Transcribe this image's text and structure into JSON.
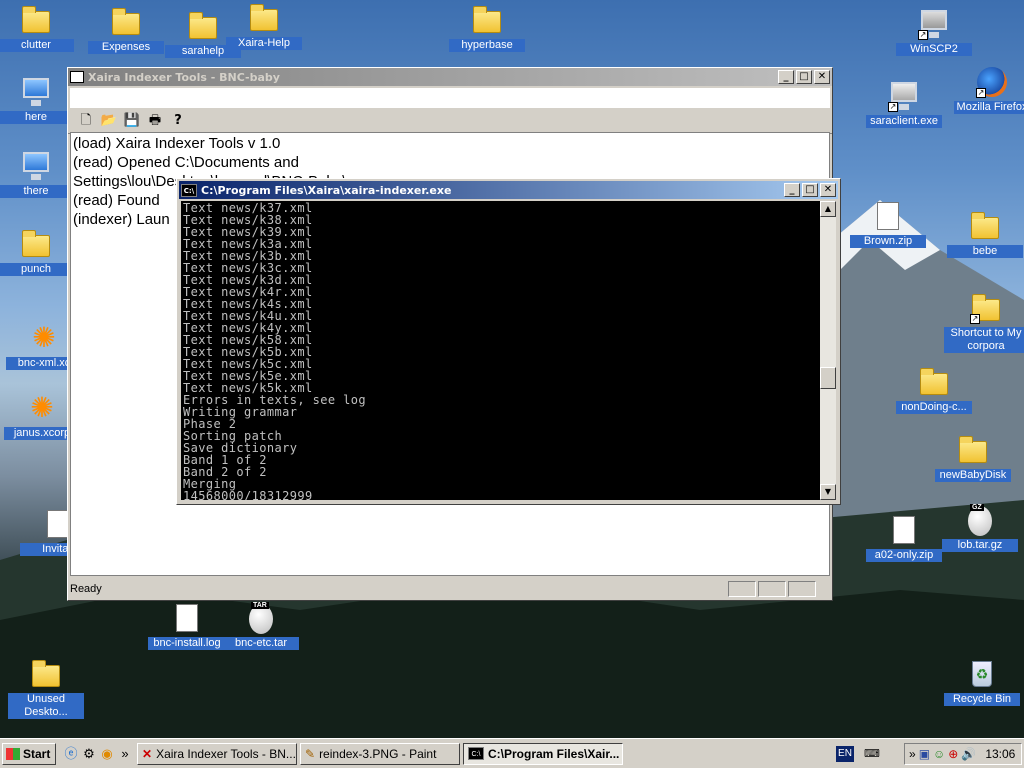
{
  "desktop": {
    "icons": [
      {
        "name": "clutter",
        "label": "clutter"
      },
      {
        "name": "expenses",
        "label": "Expenses"
      },
      {
        "name": "sarahelp",
        "label": "sarahelp"
      },
      {
        "name": "xaira-help",
        "label": "Xaira-Help"
      },
      {
        "name": "hyperbase",
        "label": "hyperbase"
      },
      {
        "name": "winscp2",
        "label": "WinSCP2"
      },
      {
        "name": "here",
        "label": "here"
      },
      {
        "name": "saraclient",
        "label": "saraclient.exe"
      },
      {
        "name": "mozilla-firefox",
        "label": "Mozilla Firefox"
      },
      {
        "name": "there",
        "label": "there"
      },
      {
        "name": "brown-zip",
        "label": "Brown.zip"
      },
      {
        "name": "bebe",
        "label": "bebe"
      },
      {
        "name": "punch",
        "label": "punch"
      },
      {
        "name": "shortcut-my-corpora",
        "label": "Shortcut to My corpora"
      },
      {
        "name": "bnc-xml",
        "label": "bnc-xml.xc"
      },
      {
        "name": "nondoing",
        "label": "nonDoing-c..."
      },
      {
        "name": "janus",
        "label": "janus.xcorp"
      },
      {
        "name": "newbabydisk",
        "label": "newBabyDisk"
      },
      {
        "name": "invitation",
        "label": "Invitati"
      },
      {
        "name": "a02-only",
        "label": "a02-only.zip"
      },
      {
        "name": "lob-tar-gz",
        "label": "lob.tar.gz"
      },
      {
        "name": "bnc-install-log",
        "label": "bnc-install.log"
      },
      {
        "name": "bnc-etc-tar",
        "label": "bnc-etc.tar"
      },
      {
        "name": "unused-desktop",
        "label": "Unused Deskto..."
      },
      {
        "name": "recycle-bin",
        "label": "Recycle Bin"
      }
    ]
  },
  "xaira_window": {
    "title": "Xaira Indexer Tools - BNC-baby",
    "log_lines": [
      "(load) Xaira Indexer Tools v 1.0",
      "(read) Opened C:\\Documents and",
      "Settings\\lou\\Desktop\\bnc-xml\\BNC-Baby\\...",
      "(read) Found",
      "(indexer) Laun"
    ],
    "status": "Ready"
  },
  "console_window": {
    "title": "C:\\Program Files\\Xaira\\xaira-indexer.exe",
    "icon_label": "C:\\",
    "lines": [
      "Text news/k37.xml",
      "Text news/k38.xml",
      "Text news/k39.xml",
      "Text news/k3a.xml",
      "Text news/k3b.xml",
      "Text news/k3c.xml",
      "Text news/k3d.xml",
      "Text news/k4r.xml",
      "Text news/k4s.xml",
      "Text news/k4u.xml",
      "Text news/k4y.xml",
      "Text news/k58.xml",
      "Text news/k5b.xml",
      "Text news/k5c.xml",
      "Text news/k5e.xml",
      "Text news/k5k.xml",
      "Errors in texts, see log",
      "Writing grammar",
      "Phase 2",
      "Sorting patch",
      "Save dictionary",
      "Band 1 of 2",
      "Band 2 of 2",
      "Merging",
      "14568000/18312999"
    ]
  },
  "taskbar": {
    "start_label": "Start",
    "tasks": [
      {
        "label": "Xaira Indexer Tools - BN...",
        "active": false
      },
      {
        "label": "reindex-3.PNG - Paint",
        "active": false
      },
      {
        "label": "C:\\Program Files\\Xair...",
        "active": true
      }
    ],
    "language": "EN",
    "clock": "13:06",
    "chevron": "»"
  }
}
